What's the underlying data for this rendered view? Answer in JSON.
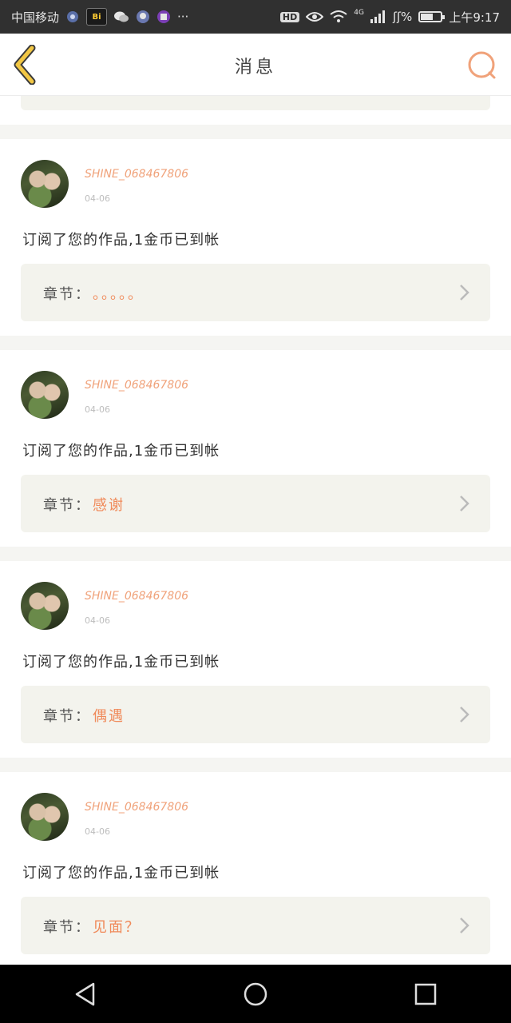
{
  "status_bar": {
    "carrier": "中国移动",
    "notification_icons": [
      "shield-app-icon",
      "bilibili-icon",
      "wechat-icon",
      "qq-icon",
      "qq-purple-icon"
    ],
    "more": "···",
    "hd": "HD",
    "network": "4G",
    "speed": "ʃʃ%",
    "time": "上午9:17"
  },
  "header": {
    "title": "消息",
    "accent_color": "#f0a27a"
  },
  "chapter_label": "章节：",
  "messages": [
    {
      "username": "SHINE_068467806",
      "date": "04-06",
      "text": "订阅了您的作品,1金币已到帐",
      "chapter": "。。。。。"
    },
    {
      "username": "SHINE_068467806",
      "date": "04-06",
      "text": "订阅了您的作品,1金币已到帐",
      "chapter": "感谢"
    },
    {
      "username": "SHINE_068467806",
      "date": "04-06",
      "text": "订阅了您的作品,1金币已到帐",
      "chapter": "偶遇"
    },
    {
      "username": "SHINE_068467806",
      "date": "04-06",
      "text": "订阅了您的作品,1金币已到帐",
      "chapter": "见面？"
    }
  ]
}
